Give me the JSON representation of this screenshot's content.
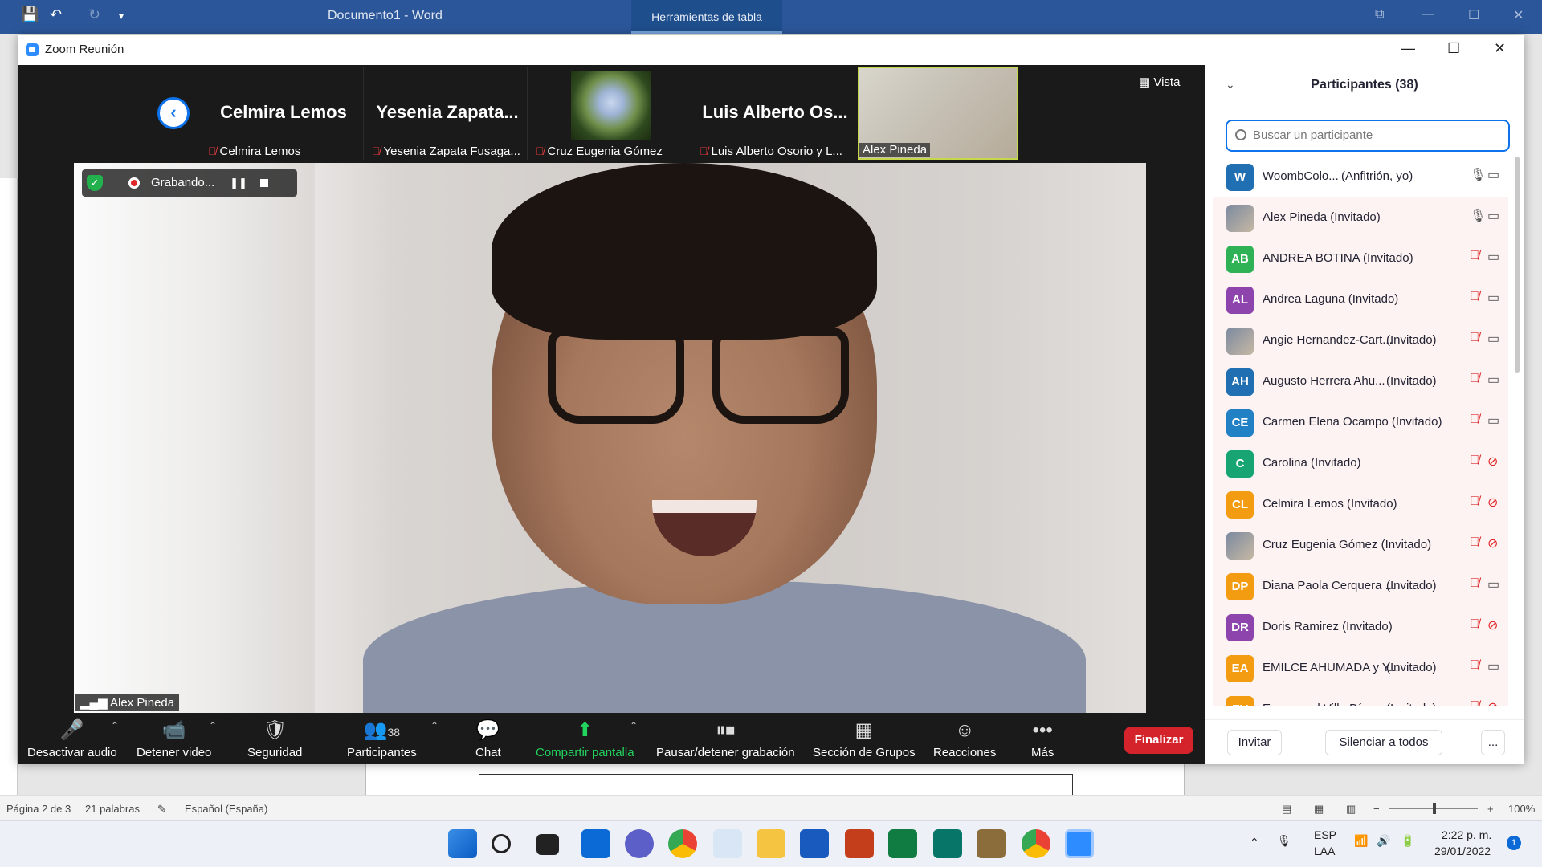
{
  "word": {
    "title": "Documento1  -  Word",
    "table_tools": "Herramientas de tabla",
    "status": {
      "page": "Página 2 de 3",
      "words": "21 palabras",
      "language": "Español (España)",
      "zoom": "100%"
    }
  },
  "taskbar": {
    "lang_top": "ESP",
    "lang_bottom": "LAA",
    "time": "2:22 p. m.",
    "date": "29/01/2022",
    "notifications": "1"
  },
  "zoom": {
    "window_title": "Zoom Reunión",
    "view_label": "Vista",
    "strip": [
      {
        "big": "Celmira Lemos",
        "caption": "Celmira Lemos"
      },
      {
        "big": "Yesenia  Zapata...",
        "caption": "Yesenia Zapata Fusaga..."
      },
      {
        "big": "",
        "caption": "Cruz Eugenia Gómez"
      },
      {
        "big": "Luis Alberto  Os...",
        "caption": "Luis Alberto Osorio y L..."
      },
      {
        "big": "",
        "caption": "Alex Pineda"
      }
    ],
    "recording_label": "Grabando...",
    "main_speaker": "Alex Pineda",
    "toolbar": {
      "audio": "Desactivar audio",
      "video": "Detener video",
      "security": "Seguridad",
      "participants": "Participantes",
      "participants_count": "38",
      "chat": "Chat",
      "share": "Compartir pantalla",
      "record": "Pausar/detener grabación",
      "breakout": "Sección de Grupos",
      "reactions": "Reacciones",
      "more": "Más",
      "end": "Finalizar"
    },
    "panel": {
      "title": "Participantes (38)",
      "search_placeholder": "Buscar un participante",
      "invite": "Invitar",
      "mute_all": "Silenciar a todos",
      "more": "...",
      "participants": [
        {
          "initials": "W",
          "color": "#1f6fb2",
          "name": "WoombColo...",
          "role": "(Anfitrión, yo)",
          "mic": "on",
          "cam": "on"
        },
        {
          "initials": "",
          "color": "photo",
          "name": "Alex Pineda (Invitado)",
          "role": "",
          "mic": "on",
          "cam": "on"
        },
        {
          "initials": "AB",
          "color": "#2fb155",
          "name": "ANDREA BOTINA (Invitado)",
          "role": "",
          "mic": "off",
          "cam": "on"
        },
        {
          "initials": "AL",
          "color": "#8e44ad",
          "name": "Andrea Laguna (Invitado)",
          "role": "",
          "mic": "off",
          "cam": "on"
        },
        {
          "initials": "",
          "color": "photo",
          "name": "Angie Hernandez-Cart...",
          "role": "(Invitado)",
          "mic": "off",
          "cam": "on"
        },
        {
          "initials": "AH",
          "color": "#1f6fb2",
          "name": "Augusto Herrera Ahu...",
          "role": "(Invitado)",
          "mic": "off",
          "cam": "on"
        },
        {
          "initials": "CE",
          "color": "#2281c4",
          "name": "Carmen Elena Ocampo (Invitado)",
          "role": "",
          "mic": "off",
          "cam": "on"
        },
        {
          "initials": "C",
          "color": "#17a673",
          "name": "Carolina (Invitado)",
          "role": "",
          "mic": "off",
          "cam": "off"
        },
        {
          "initials": "CL",
          "color": "#f39c12",
          "name": "Celmira Lemos (Invitado)",
          "role": "",
          "mic": "off",
          "cam": "off"
        },
        {
          "initials": "",
          "color": "photo",
          "name": "Cruz Eugenia Gómez (Invitado)",
          "role": "",
          "mic": "off",
          "cam": "off"
        },
        {
          "initials": "DP",
          "color": "#f39c12",
          "name": "Diana Paola Cerquera ...",
          "role": "(Invitado)",
          "mic": "off",
          "cam": "on"
        },
        {
          "initials": "DR",
          "color": "#8e44ad",
          "name": "Doris Ramirez (Invitado)",
          "role": "",
          "mic": "off",
          "cam": "off"
        },
        {
          "initials": "EA",
          "color": "#f39c12",
          "name": "EMILCE AHUMADA y Y...",
          "role": "(Invitado)",
          "mic": "off",
          "cam": "on"
        },
        {
          "initials": "EV",
          "color": "#f39c12",
          "name": "Emmanuel Villa Díaz ...",
          "role": "(Invitado)",
          "mic": "off",
          "cam": "off"
        }
      ]
    }
  }
}
